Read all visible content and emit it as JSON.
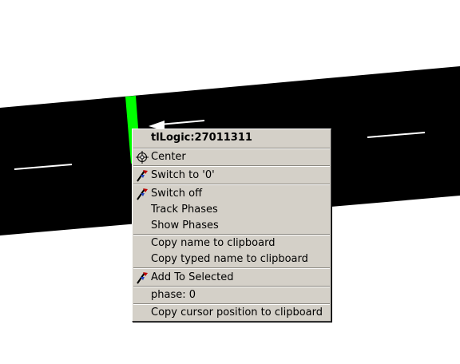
{
  "colors": {
    "background": "#ffffff",
    "road": "#000000",
    "lane_markings": "#ffffff",
    "signal": "#00ff00",
    "menu_bg": "#d4d0c8"
  },
  "menu": {
    "title": "tlLogic:27011311",
    "center": "Center",
    "switch_to": "Switch to '0'",
    "switch_off": "Switch off",
    "track_phases": "Track Phases",
    "show_phases": "Show Phases",
    "copy_name": "Copy name to clipboard",
    "copy_typed_name": "Copy typed name to clipboard",
    "add_to_selected": "Add To Selected",
    "phase": "phase: 0",
    "copy_cursor": "Copy cursor position to clipboard"
  }
}
